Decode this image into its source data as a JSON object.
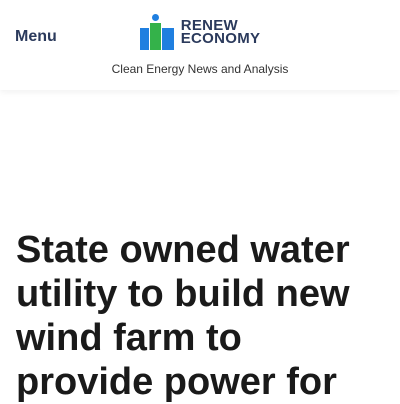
{
  "header": {
    "menu_label": "Menu",
    "logo": {
      "word1": "RENEW",
      "word2": "ECONOMY",
      "colors": {
        "blue": "#1f7fe0",
        "green": "#34b24a",
        "text": "#2b3a5c"
      }
    },
    "tagline": "Clean Energy News and Analysis"
  },
  "article": {
    "title": "State owned water utility to build new wind farm to provide power for"
  }
}
